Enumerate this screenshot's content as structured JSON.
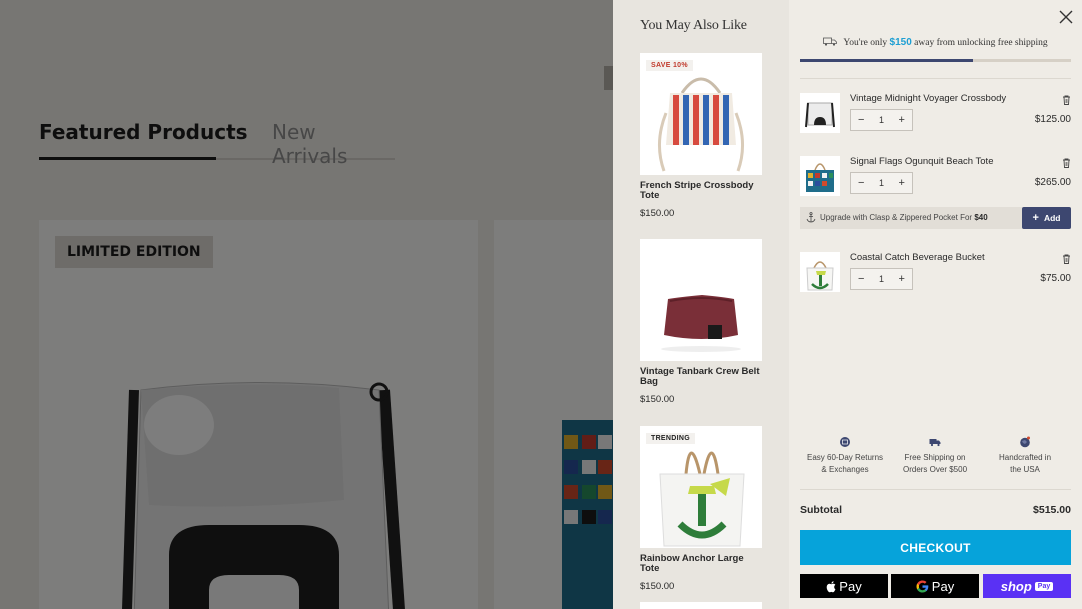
{
  "background": {
    "tabs": [
      {
        "label": "Featured Products"
      },
      {
        "label": "New Arrivals"
      }
    ],
    "card_badge": "LIMITED EDITION"
  },
  "recommendations": {
    "title": "You May Also Like",
    "items": [
      {
        "name": "French Stripe Crossbody Tote",
        "price": "$150.00",
        "badge": "SAVE 10%"
      },
      {
        "name": "Vintage Tanbark Crew Belt Bag",
        "price": "$150.00",
        "badge": ""
      },
      {
        "name": "Rainbow Anchor Large Tote",
        "price": "$150.00",
        "badge": "TRENDING"
      }
    ]
  },
  "cart": {
    "shipping_prefix": "You're only",
    "shipping_amount": "$150",
    "shipping_suffix": "away from unlocking free shipping",
    "shipping_progress": 0.64,
    "items": [
      {
        "name": "Vintage Midnight Voyager Crossbody",
        "qty": "1",
        "price": "$125.00"
      },
      {
        "name": "Signal Flags Ogunquit Beach Tote",
        "qty": "1",
        "price": "$265.00"
      },
      {
        "name": "Coastal Catch Beverage Bucket",
        "qty": "1",
        "price": "$75.00"
      }
    ],
    "upsell": {
      "text": "Upgrade with Clasp & Zippered Pocket For",
      "price": "$40",
      "button": "Add"
    },
    "perks": [
      {
        "line1": "Easy 60-Day Returns",
        "line2": "& Exchanges"
      },
      {
        "line1": "Free Shipping on",
        "line2": "Orders Over $500"
      },
      {
        "line1": "Handcrafted in",
        "line2": "the USA"
      }
    ],
    "subtotal_label": "Subtotal",
    "subtotal_value": "$515.00",
    "checkout_label": "CHECKOUT",
    "apple_pay": "Pay",
    "google_pay": "Pay",
    "shop_pay": "shop",
    "shop_pay_box": "Pay"
  },
  "colors": {
    "accent_blue": "#06a3da",
    "navy": "#3d4770",
    "shop_purple": "#5a31f4",
    "price_highlight": "#1e9fd3"
  }
}
